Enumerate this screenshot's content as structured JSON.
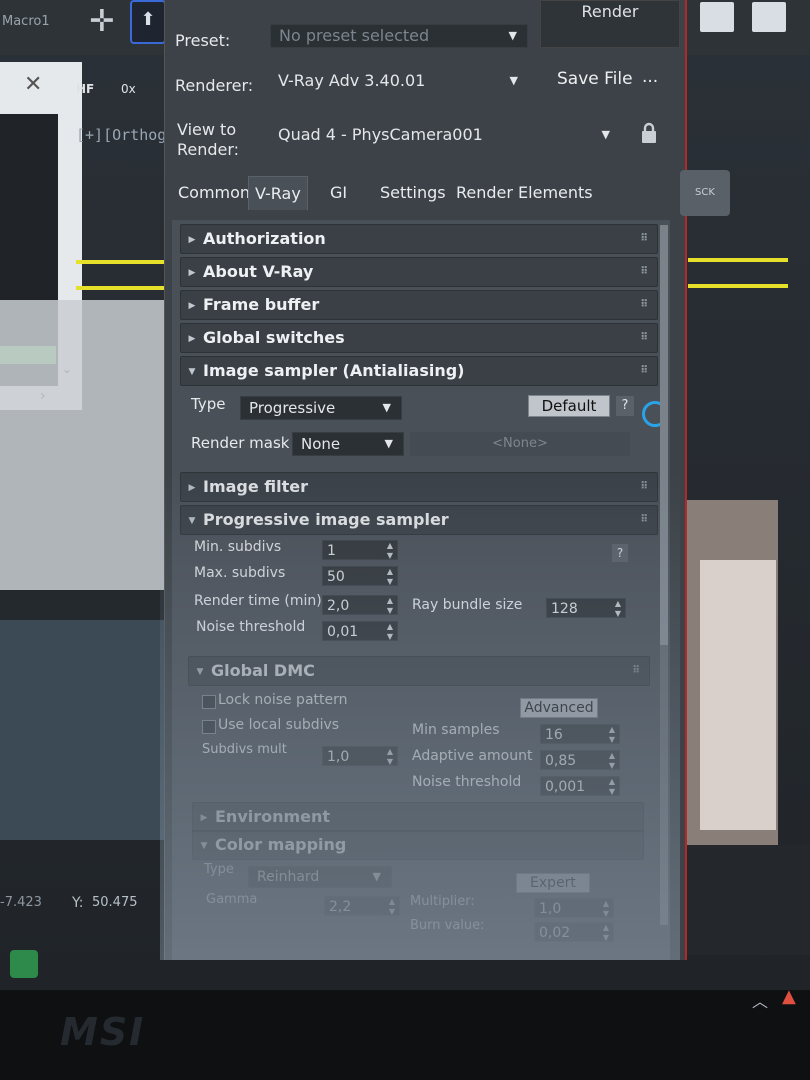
{
  "topbar": {
    "macro": "Macro1",
    "render_label": "Render"
  },
  "left_window": {
    "hf": "HF",
    "zero_x": "0x",
    "ortho": "[+][Orthog"
  },
  "coords": {
    "x": "-7.423",
    "y_label": "Y:",
    "y_value": "50.475"
  },
  "render_setup": {
    "preset_label": "Preset:",
    "preset_value": "No preset selected",
    "renderer_label": "Renderer:",
    "renderer_value": "V-Ray Adv 3.40.01",
    "save_file": "Save File",
    "more": "...",
    "view_label_1": "View to",
    "view_label_2": "Render:",
    "view_value": "Quad 4 - PhysCamera001",
    "tabs": [
      {
        "label": "Common"
      },
      {
        "label": "V-Ray"
      },
      {
        "label": "GI"
      },
      {
        "label": "Settings"
      },
      {
        "label": "Render Elements"
      }
    ],
    "tab_icon_text": "SCK"
  },
  "rollouts": {
    "authorization": "Authorization",
    "about": "About V-Ray",
    "frame_buffer": "Frame buffer",
    "global_switches": "Global switches",
    "image_sampler": "Image sampler (Antialiasing)",
    "image_filter": "Image filter",
    "progressive": "Progressive image sampler",
    "global_dmc": "Global DMC",
    "environment": "Environment",
    "color_mapping": "Color mapping"
  },
  "image_sampler": {
    "type_label": "Type",
    "type_value": "Progressive",
    "default_btn": "Default",
    "help": "?",
    "render_mask_label": "Render mask",
    "render_mask_value": "None",
    "render_mask_none": "<None>"
  },
  "progressive": {
    "min_subdivs_label": "Min. subdivs",
    "min_subdivs_value": "1",
    "max_subdivs_label": "Max. subdivs",
    "max_subdivs_value": "50",
    "render_time_label": "Render time (min)",
    "render_time_value": "2,0",
    "ray_bundle_label": "Ray bundle size",
    "ray_bundle_value": "128",
    "noise_threshold_label": "Noise threshold",
    "noise_threshold_value": "0,01",
    "help": "?"
  },
  "global_dmc": {
    "lock_noise": "Lock noise pattern",
    "use_local": "Use local subdivs",
    "advanced_btn": "Advanced",
    "subdivs_mult_label": "Subdivs mult",
    "subdivs_mult_value": "1,0",
    "min_samples_label": "Min samples",
    "min_samples_value": "16",
    "adaptive_label": "Adaptive amount",
    "adaptive_value": "0,85",
    "noise_label": "Noise threshold",
    "noise_value": "0,001"
  },
  "color_mapping": {
    "type_label": "Type",
    "type_value": "Reinhard",
    "expert_btn": "Expert",
    "gamma_label": "Gamma",
    "gamma_value": "2,2",
    "multiplier_label": "Multiplier:",
    "multiplier_value": "1,0",
    "burn_label": "Burn value:",
    "burn_value": "0,02"
  }
}
